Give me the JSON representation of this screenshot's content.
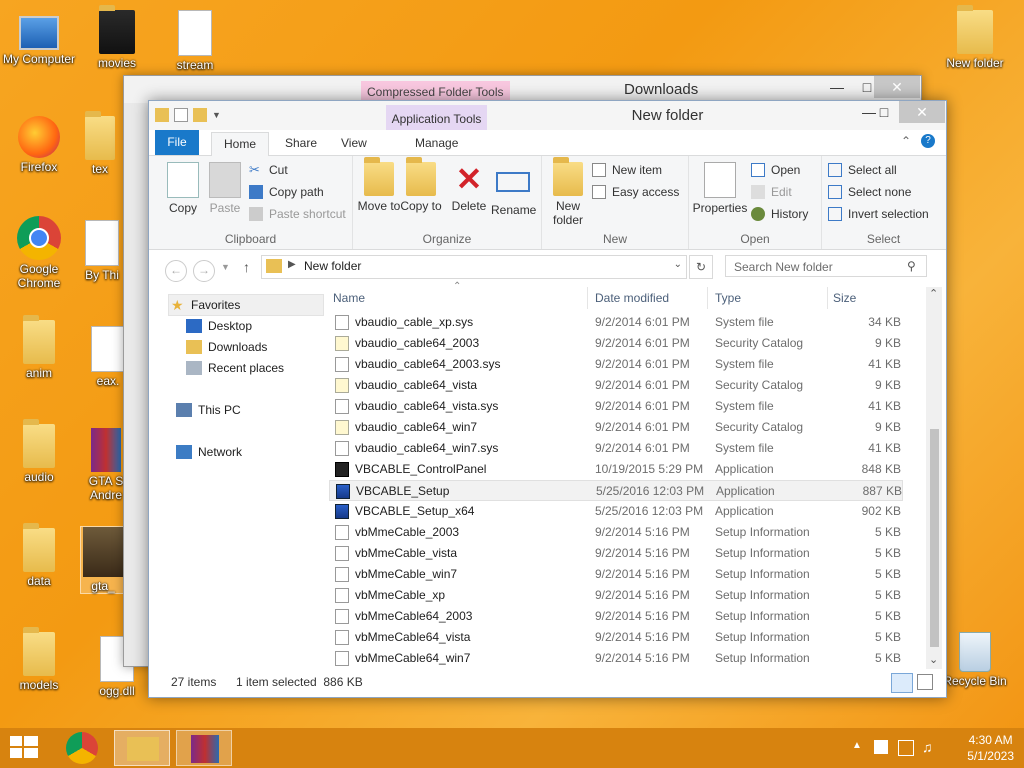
{
  "desktop": {
    "icons": [
      {
        "label": "My Computer"
      },
      {
        "label": "movies"
      },
      {
        "label": "stream"
      },
      {
        "label": "New folder"
      },
      {
        "label": "Firefox"
      },
      {
        "label": "tex"
      },
      {
        "label": "Google Chrome"
      },
      {
        "label": "By Thi"
      },
      {
        "label": "anim"
      },
      {
        "label": "eax."
      },
      {
        "label": "audio"
      },
      {
        "label": "GTA S Andre"
      },
      {
        "label": "data"
      },
      {
        "label": "gta_"
      },
      {
        "label": "models"
      },
      {
        "label": "ogg.dll"
      },
      {
        "label": "Recycle Bin"
      }
    ]
  },
  "back_window": {
    "context_tab": "Compressed Folder Tools",
    "title": "Downloads"
  },
  "window": {
    "context_tab": "Application Tools",
    "title": "New folder",
    "tabs": [
      "File",
      "Home",
      "Share",
      "View",
      "Manage"
    ]
  },
  "ribbon": {
    "clipboard": {
      "label": "Clipboard",
      "copy": "Copy",
      "paste": "Paste",
      "cut": "Cut",
      "copy_path": "Copy path",
      "paste_shortcut": "Paste shortcut"
    },
    "organize": {
      "label": "Organize",
      "move_to": "Move to",
      "copy_to": "Copy to",
      "delete": "Delete",
      "rename": "Rename"
    },
    "new": {
      "label": "New",
      "new_folder": "New folder",
      "new_item": "New item",
      "easy_access": "Easy access"
    },
    "open": {
      "label": "Open",
      "properties": "Properties",
      "open": "Open",
      "edit": "Edit",
      "history": "History"
    },
    "select": {
      "label": "Select",
      "select_all": "Select all",
      "select_none": "Select none",
      "invert": "Invert selection"
    }
  },
  "address": {
    "path": "New folder",
    "search_placeholder": "Search New folder"
  },
  "nav": {
    "favorites": "Favorites",
    "desktop": "Desktop",
    "downloads": "Downloads",
    "recent": "Recent places",
    "this_pc": "This PC",
    "network": "Network"
  },
  "columns": {
    "name": "Name",
    "date": "Date modified",
    "type": "Type",
    "size": "Size"
  },
  "files": [
    {
      "name": "vbaudio_cable_xp.sys",
      "date": "9/2/2014 6:01 PM",
      "type": "System file",
      "size": "34 KB",
      "icon": "sys"
    },
    {
      "name": "vbaudio_cable64_2003",
      "date": "9/2/2014 6:01 PM",
      "type": "Security Catalog",
      "size": "9 KB",
      "icon": "cat"
    },
    {
      "name": "vbaudio_cable64_2003.sys",
      "date": "9/2/2014 6:01 PM",
      "type": "System file",
      "size": "41 KB",
      "icon": "sys"
    },
    {
      "name": "vbaudio_cable64_vista",
      "date": "9/2/2014 6:01 PM",
      "type": "Security Catalog",
      "size": "9 KB",
      "icon": "cat"
    },
    {
      "name": "vbaudio_cable64_vista.sys",
      "date": "9/2/2014 6:01 PM",
      "type": "System file",
      "size": "41 KB",
      "icon": "sys"
    },
    {
      "name": "vbaudio_cable64_win7",
      "date": "9/2/2014 6:01 PM",
      "type": "Security Catalog",
      "size": "9 KB",
      "icon": "cat"
    },
    {
      "name": "vbaudio_cable64_win7.sys",
      "date": "9/2/2014 6:01 PM",
      "type": "System file",
      "size": "41 KB",
      "icon": "sys"
    },
    {
      "name": "VBCABLE_ControlPanel",
      "date": "10/19/2015 5:29 PM",
      "type": "Application",
      "size": "848 KB",
      "icon": "vb"
    },
    {
      "name": "VBCABLE_Setup",
      "date": "5/25/2016 12:03 PM",
      "type": "Application",
      "size": "887 KB",
      "icon": "setup",
      "selected": true
    },
    {
      "name": "VBCABLE_Setup_x64",
      "date": "5/25/2016 12:03 PM",
      "type": "Application",
      "size": "902 KB",
      "icon": "setup"
    },
    {
      "name": "vbMmeCable_2003",
      "date": "9/2/2014 5:16 PM",
      "type": "Setup Information",
      "size": "5 KB",
      "icon": "inf"
    },
    {
      "name": "vbMmeCable_vista",
      "date": "9/2/2014 5:16 PM",
      "type": "Setup Information",
      "size": "5 KB",
      "icon": "inf"
    },
    {
      "name": "vbMmeCable_win7",
      "date": "9/2/2014 5:16 PM",
      "type": "Setup Information",
      "size": "5 KB",
      "icon": "inf"
    },
    {
      "name": "vbMmeCable_xp",
      "date": "9/2/2014 5:16 PM",
      "type": "Setup Information",
      "size": "5 KB",
      "icon": "inf"
    },
    {
      "name": "vbMmeCable64_2003",
      "date": "9/2/2014 5:16 PM",
      "type": "Setup Information",
      "size": "5 KB",
      "icon": "inf"
    },
    {
      "name": "vbMmeCable64_vista",
      "date": "9/2/2014 5:16 PM",
      "type": "Setup Information",
      "size": "5 KB",
      "icon": "inf"
    },
    {
      "name": "vbMmeCable64_win7",
      "date": "9/2/2014 5:16 PM",
      "type": "Setup Information",
      "size": "5 KB",
      "icon": "inf"
    }
  ],
  "status": {
    "items": "27 items",
    "selected": "1 item selected  886 KB"
  },
  "taskbar": {
    "time": "4:30 AM",
    "date": "5/1/2023"
  },
  "colors": {
    "accent": "#1979ca",
    "taskbar": "#d7830f",
    "context_app": "#e5d7f3",
    "context_zip": "#f8c7df"
  }
}
